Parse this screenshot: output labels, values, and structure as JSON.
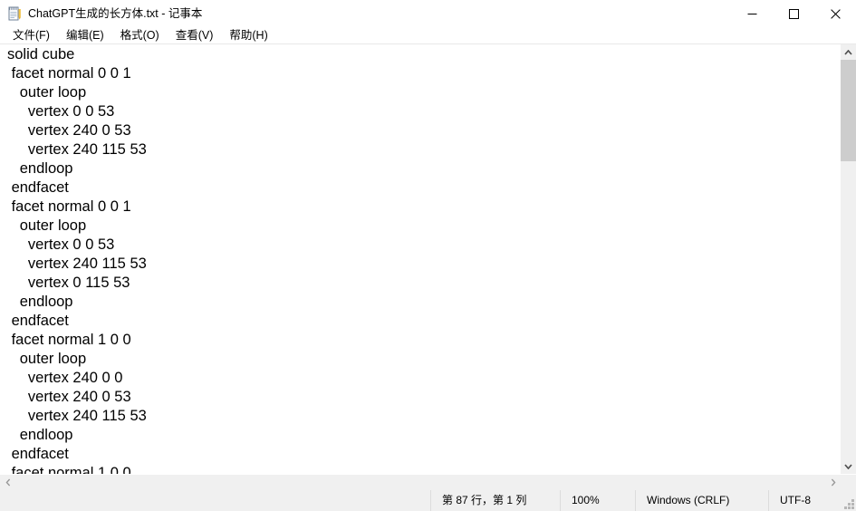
{
  "window": {
    "title": "ChatGPT生成的长方体.txt - 记事本",
    "icon": "notepad-icon",
    "controls": {
      "minimize": "minimize-icon",
      "maximize": "maximize-icon",
      "close": "close-icon"
    }
  },
  "menubar": {
    "items": [
      {
        "label": "文件(F)"
      },
      {
        "label": "编辑(E)"
      },
      {
        "label": "格式(O)"
      },
      {
        "label": "查看(V)"
      },
      {
        "label": "帮助(H)"
      }
    ]
  },
  "editor": {
    "content": "solid cube\n facet normal 0 0 1\n   outer loop\n     vertex 0 0 53\n     vertex 240 0 53\n     vertex 240 115 53\n   endloop\n endfacet\n facet normal 0 0 1\n   outer loop\n     vertex 0 0 53\n     vertex 240 115 53\n     vertex 0 115 53\n   endloop\n endfacet\n facet normal 1 0 0\n   outer loop\n     vertex 240 0 0\n     vertex 240 0 53\n     vertex 240 115 53\n   endloop\n endfacet\n facet normal 1 0 0"
  },
  "scrollbars": {
    "vertical": {
      "up_arrow": "chevron-up-icon",
      "down_arrow": "chevron-down-icon"
    },
    "horizontal": {
      "left_arrow": "chevron-left-icon",
      "right_arrow": "chevron-right-icon"
    }
  },
  "statusbar": {
    "position": "第 87 行，第 1 列",
    "zoom": "100%",
    "line_ending": "Windows (CRLF)",
    "encoding": "UTF-8"
  },
  "colors": {
    "titlebar_bg": "#ffffff",
    "chrome_bg": "#f0f0f0",
    "scroll_thumb": "#cdcdcd",
    "text": "#000000",
    "separator": "#dcdcdc"
  }
}
